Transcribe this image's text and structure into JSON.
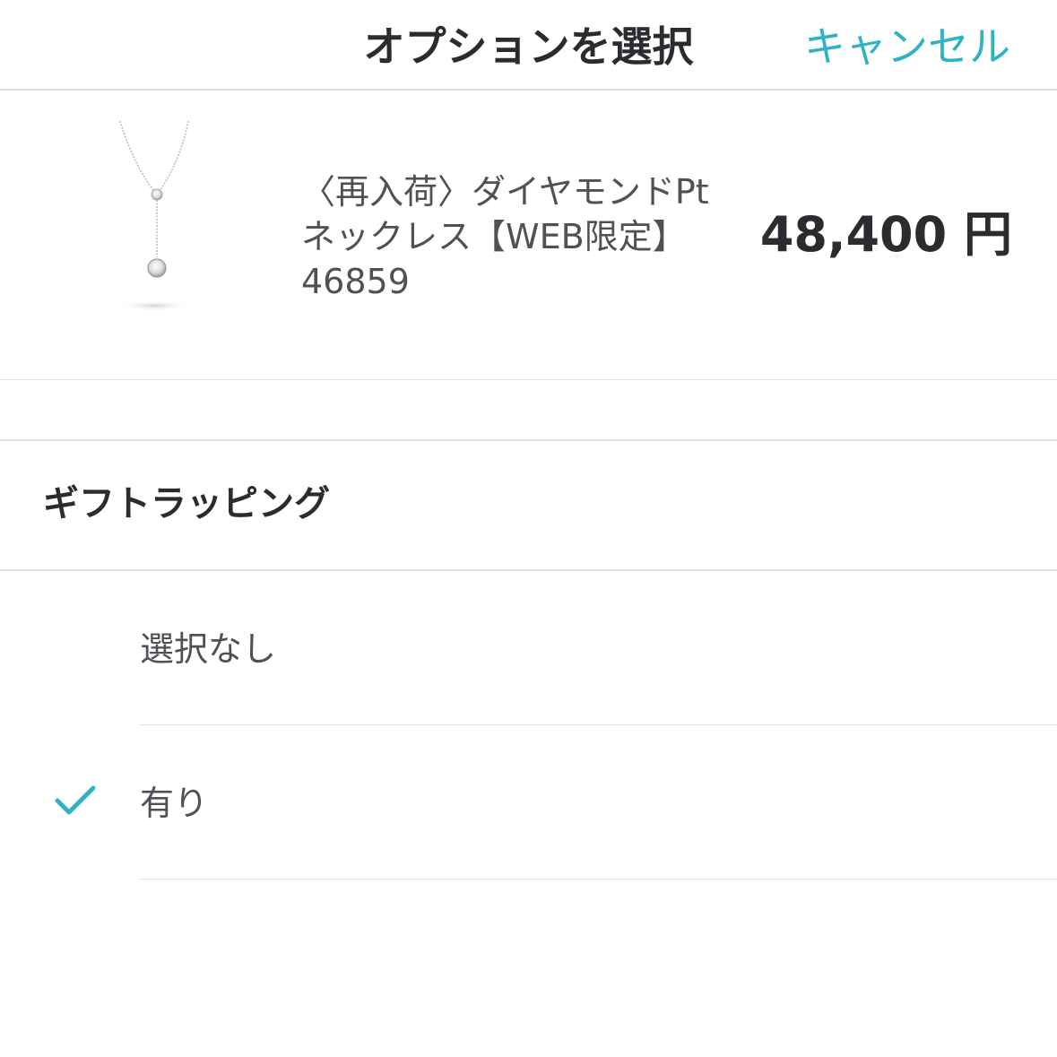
{
  "header": {
    "title": "オプションを選択",
    "cancel_label": "キャンセル"
  },
  "product": {
    "name_line1": "〈再入荷〉ダイヤモンドPt",
    "name_line2": "ネックレス【WEB限定】",
    "code": "46859",
    "price": "48,400 円",
    "image_icon": "necklace-image"
  },
  "gift_section": {
    "title": "ギフトラッピング",
    "options": [
      {
        "label": "選択なし",
        "selected": false
      },
      {
        "label": "有り",
        "selected": true
      }
    ]
  },
  "colors": {
    "accent": "#2fb3c4",
    "text": "#2b2b30",
    "divider": "#e2e2e2"
  }
}
